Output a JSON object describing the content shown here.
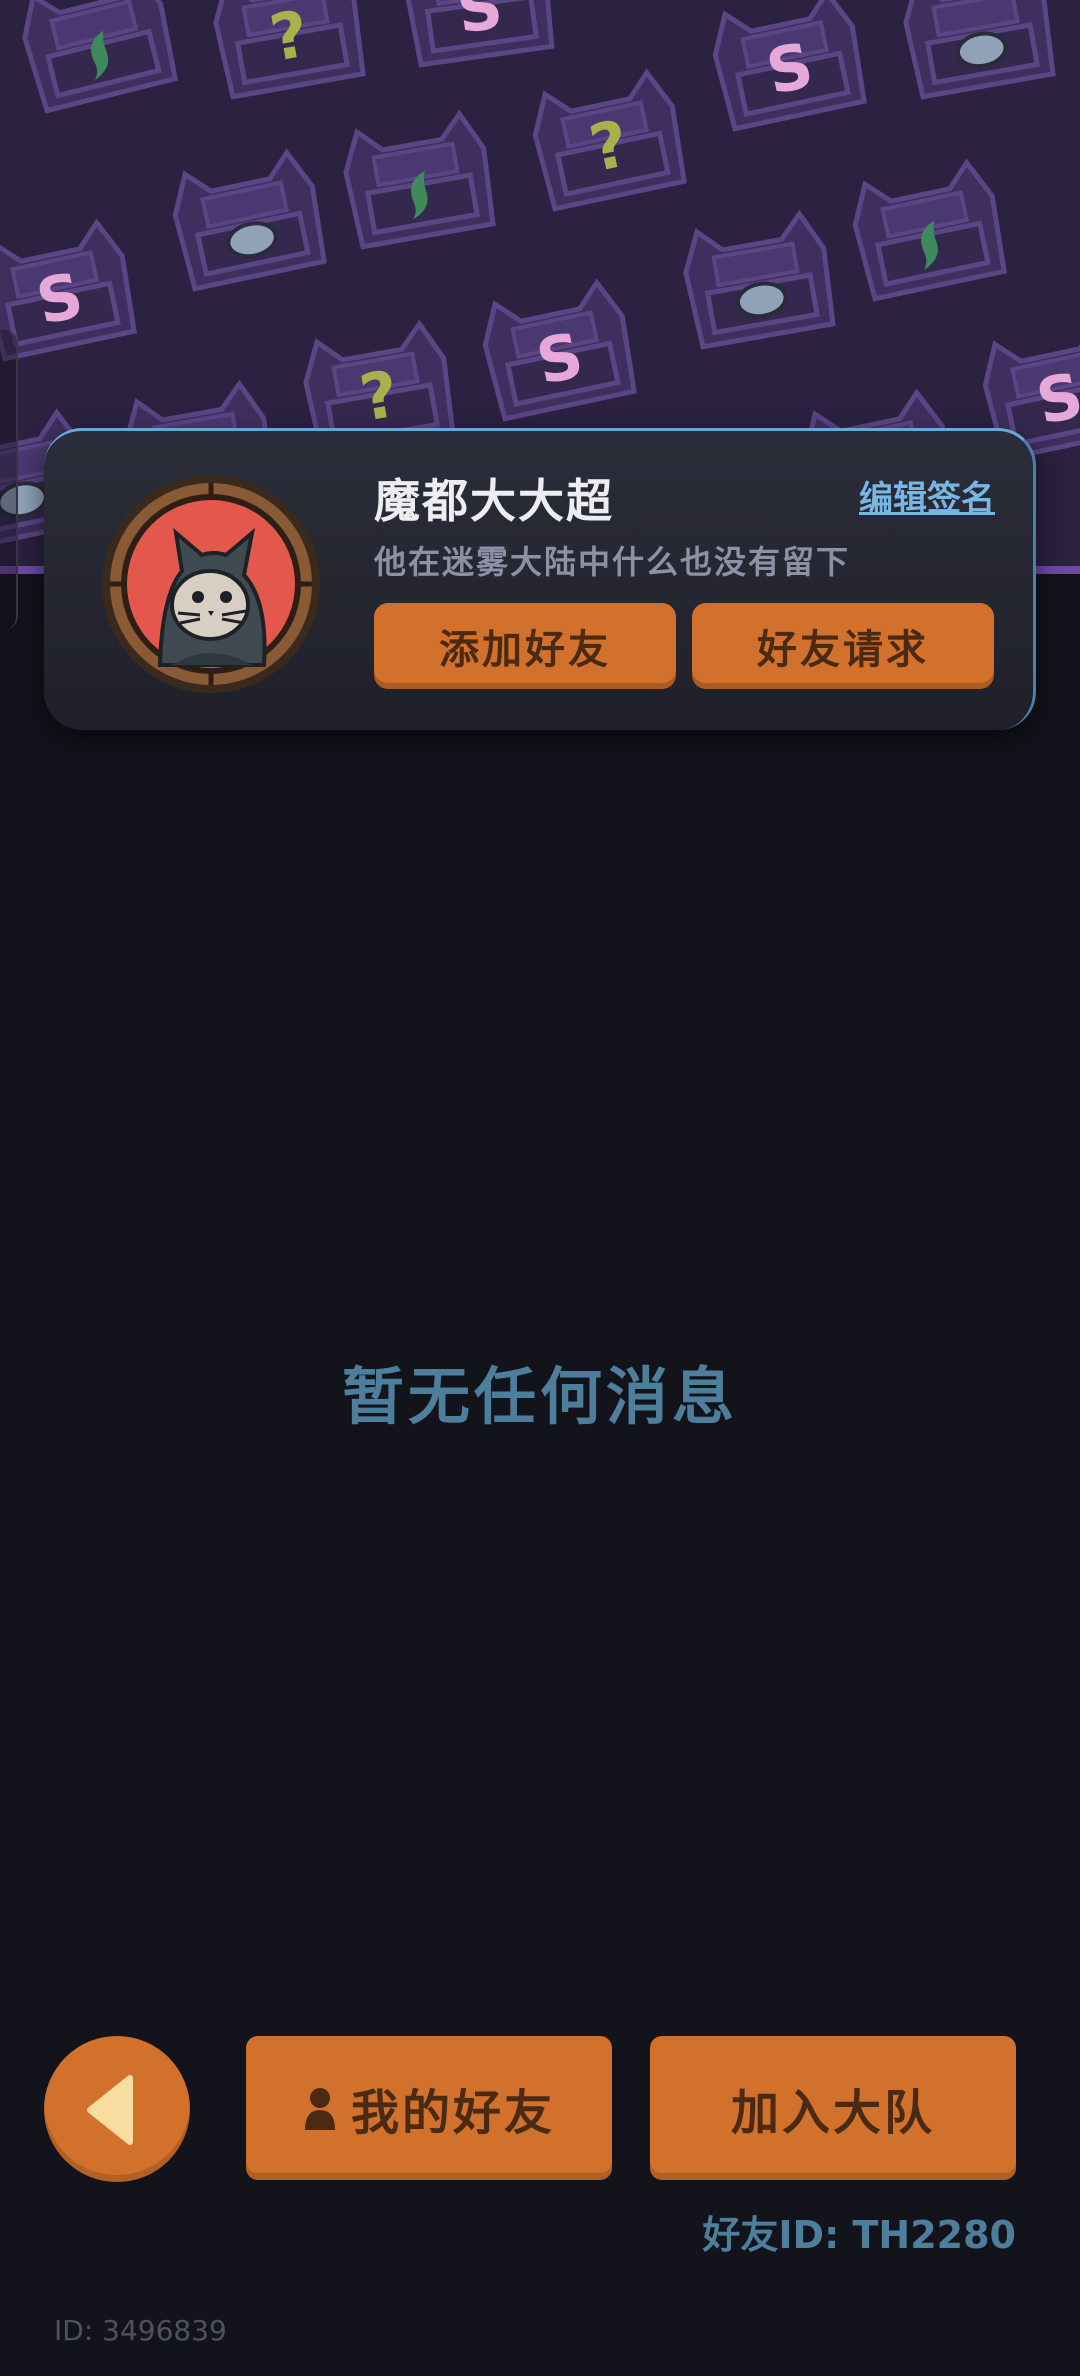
{
  "profile": {
    "nickname": "魔都大大超",
    "edit_signature_label": "编辑签名",
    "signature": "他在迷雾大陆中什么也没有留下",
    "add_friend_label": "添加好友",
    "friend_request_label": "好友请求",
    "avatar_icon": "hooded-cat-avatar"
  },
  "messages": {
    "empty_text": "暂无任何消息"
  },
  "bottom_bar": {
    "back_icon": "triangle-left-icon",
    "my_friends_label": "我的好友",
    "my_friends_icon": "person-icon",
    "join_team_label": "加入大队",
    "friend_id": "好友ID: TH2280"
  },
  "footer": {
    "user_id": "ID: 3496839"
  },
  "colors": {
    "background": "#13131c",
    "banner": "#2b2140",
    "accent_orange": "#d2712b",
    "button_text": "#4b2a14",
    "muted_blue": "#4d7f9c",
    "link_blue": "#78b6e4"
  }
}
